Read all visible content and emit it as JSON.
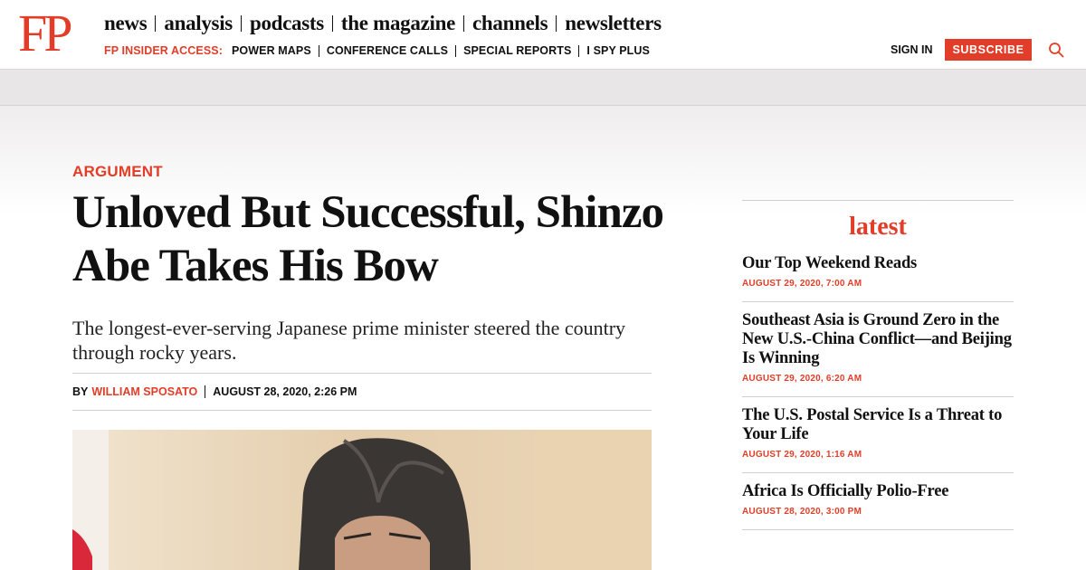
{
  "header": {
    "logo": "FP",
    "nav": [
      "news",
      "analysis",
      "podcasts",
      "the magazine",
      "channels",
      "newsletters"
    ],
    "insider_label": "FP INSIDER ACCESS:",
    "insider_links": [
      "POWER MAPS",
      "CONFERENCE CALLS",
      "SPECIAL REPORTS",
      "I SPY PLUS"
    ],
    "sign_in": "SIGN IN",
    "subscribe": "SUBSCRIBE"
  },
  "article": {
    "kicker": "ARGUMENT",
    "headline": "Unloved But Successful, Shinzo Abe Takes His Bow",
    "dek": "The longest-ever-serving Japanese prime minister steered the country through rocky years.",
    "by": "BY",
    "author": "WILLIAM SPOSATO",
    "date": "AUGUST 28, 2020, 2:26 PM"
  },
  "sidebar": {
    "title": "latest",
    "items": [
      {
        "title": "Our Top Weekend Reads",
        "date": "AUGUST 29, 2020, 7:00 AM"
      },
      {
        "title": "Southeast Asia is Ground Zero in the New U.S.-China Conflict—and Beijing Is Winning",
        "date": "AUGUST 29, 2020, 6:20 AM"
      },
      {
        "title": "The U.S. Postal Service Is a Threat to Your Life",
        "date": "AUGUST 29, 2020, 1:16 AM"
      },
      {
        "title": "Africa Is Officially Polio-Free",
        "date": "AUGUST 28, 2020, 3:00 PM"
      }
    ]
  },
  "colors": {
    "brand": "#e23d28",
    "band": "#e8e6e6"
  },
  "icons": {
    "search": "search-icon"
  }
}
